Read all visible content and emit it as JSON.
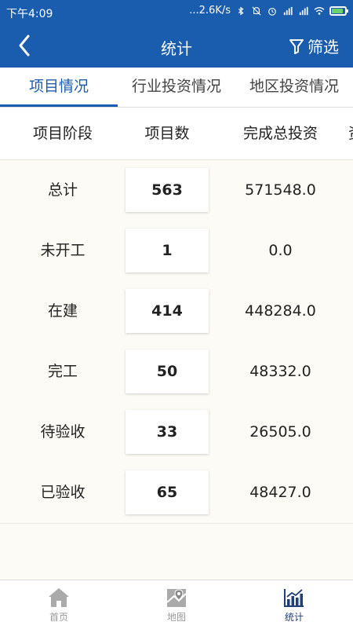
{
  "status_bar": {
    "time": "下午4:09",
    "speed": "...2.6K/s",
    "battery_color": "#6bd26b"
  },
  "app_bar": {
    "title": "统计",
    "filter_label": "筛选",
    "background": "#1a5dae"
  },
  "tabs": [
    {
      "label": "项目情况",
      "active": true
    },
    {
      "label": "行业投资情况",
      "active": false
    },
    {
      "label": "地区投资情况",
      "active": false
    }
  ],
  "table": {
    "headers": [
      "项目阶段",
      "项目数",
      "完成总投资"
    ],
    "rows": [
      {
        "stage": "总计",
        "count": "563",
        "investment": "571548.0"
      },
      {
        "stage": "未开工",
        "count": "1",
        "investment": "0.0"
      },
      {
        "stage": "在建",
        "count": "414",
        "investment": "448284.0"
      },
      {
        "stage": "完工",
        "count": "50",
        "investment": "48332.0"
      },
      {
        "stage": "待验收",
        "count": "33",
        "investment": "26505.0"
      },
      {
        "stage": "已验收",
        "count": "65",
        "investment": "48427.0"
      }
    ]
  },
  "bottom_nav": [
    {
      "label": "首页",
      "icon": "home-icon",
      "active": false
    },
    {
      "label": "地图",
      "icon": "map-icon",
      "active": false
    },
    {
      "label": "统计",
      "icon": "chart-icon",
      "active": true
    }
  ],
  "colors": {
    "primary": "#1a5dae",
    "nav_active": "#1f3e7a"
  }
}
